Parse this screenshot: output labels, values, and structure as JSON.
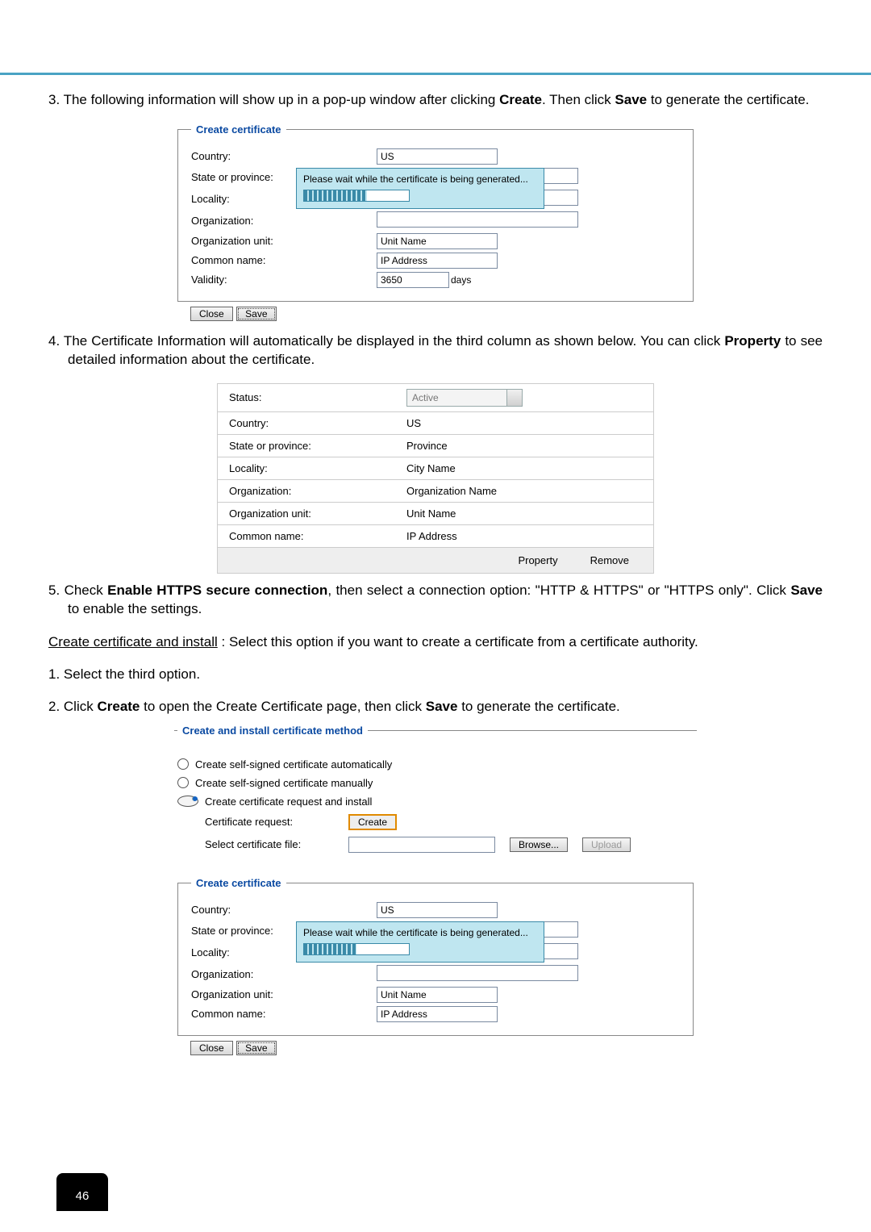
{
  "step3": "3. The following information will show up in a pop-up window after clicking ",
  "step3_bold1": "Create",
  "step3_mid": ". Then click ",
  "step3_bold2": "Save",
  "step3_end": " to generate the certificate.",
  "panel1": {
    "legend": "Create certificate",
    "country_lbl": "Country:",
    "country_val": "US",
    "state_lbl": "State or province:",
    "locality_lbl": "Locality:",
    "org_lbl": "Organization:",
    "orgunit_lbl": "Organization unit:",
    "orgunit_val": "Unit Name",
    "common_lbl": "Common name:",
    "common_val": "IP Address",
    "validity_lbl": "Validity:",
    "validity_val": "3650",
    "validity_unit": "days",
    "overlay_msg": "Please wait while the certificate is being generated...",
    "close": "Close",
    "save": "Save"
  },
  "step4": "4. The Certificate Information will automatically be displayed in the third column as shown below. You can click ",
  "step4_bold": "Property",
  "step4_end": " to see detailed information about the certificate.",
  "cert": {
    "status_lbl": "Status:",
    "status_val": "Active",
    "country_lbl": "Country:",
    "country_val": "US",
    "state_lbl": "State or province:",
    "state_val": "Province",
    "locality_lbl": "Locality:",
    "locality_val": "City Name",
    "org_lbl": "Organization:",
    "org_val": "Organization Name",
    "orgunit_lbl": "Organization unit:",
    "orgunit_val": "Unit Name",
    "common_lbl": "Common name:",
    "common_val": "IP Address",
    "property": "Property",
    "remove": "Remove"
  },
  "step5a": "5. Check ",
  "step5_bold1": "Enable HTTPS secure connection",
  "step5b": ", then select a connection option: \"HTTP & HTTPS\" or \"HTTPS only\". Click ",
  "step5_bold2": "Save",
  "step5c": " to enable the settings.",
  "cci_head_underline": "Create certificate and install",
  "cci_head_rest": "  :  Select this option if you want to create a certificate from a certificate authority.",
  "cci_step1": "1. Select the third option.",
  "cci_step2a": "2. Click ",
  "cci_step2_bold1": "Create",
  "cci_step2b": " to open the Create Certificate page, then click ",
  "cci_step2_bold2": "Save",
  "cci_step2c": " to generate the certificate.",
  "method": {
    "legend": "Create and install certificate method",
    "opt1": "Create self-signed certificate automatically",
    "opt2": "Create self-signed certificate manually",
    "opt3": "Create certificate request and install",
    "req_lbl": "Certificate request:",
    "create": "Create",
    "file_lbl": "Select certificate file:",
    "browse": "Browse...",
    "upload": "Upload"
  },
  "panel2": {
    "legend": "Create certificate",
    "country_lbl": "Country:",
    "country_val": "US",
    "state_lbl": "State or province:",
    "locality_lbl": "Locality:",
    "org_lbl": "Organization:",
    "orgunit_lbl": "Organization unit:",
    "orgunit_val": "Unit Name",
    "common_lbl": "Common name:",
    "common_val": "IP Address",
    "overlay_msg": "Please wait while the certificate is being generated...",
    "close": "Close",
    "save": "Save"
  },
  "page_number": "46"
}
